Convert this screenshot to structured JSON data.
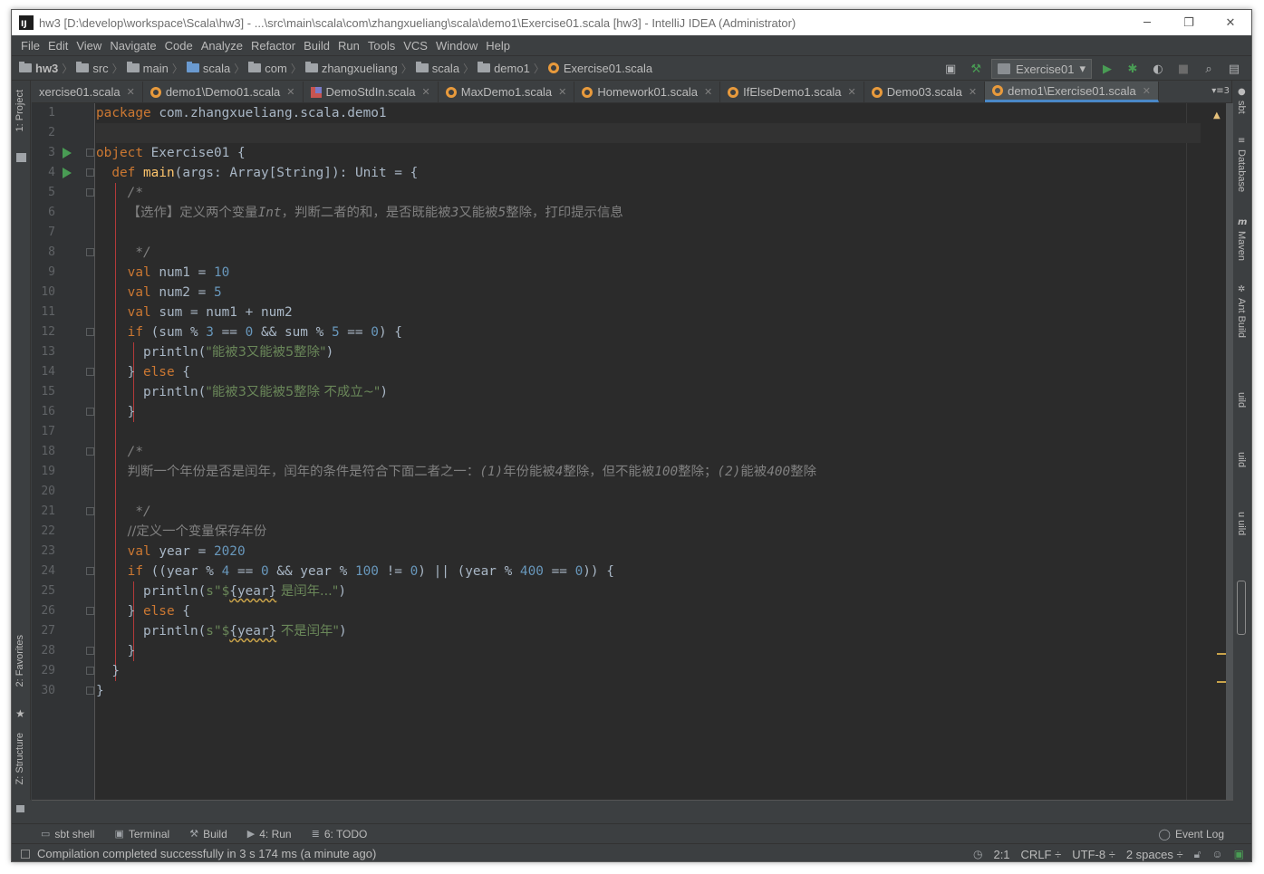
{
  "window": {
    "title": "hw3 [D:\\develop\\workspace\\Scala\\hw3] - ...\\src\\main\\scala\\com\\zhangxueliang\\scala\\demo1\\Exercise01.scala [hw3] - IntelliJ IDEA (Administrator)",
    "app_icon_text": "IJ",
    "controls": [
      "─",
      "❐",
      "✕"
    ]
  },
  "menu": [
    "File",
    "Edit",
    "View",
    "Navigate",
    "Code",
    "Analyze",
    "Refactor",
    "Build",
    "Run",
    "Tools",
    "VCS",
    "Window",
    "Help"
  ],
  "breadcrumbs": [
    "hw3",
    "src",
    "main",
    "scala",
    "com",
    "zhangxueliang",
    "scala",
    "demo1",
    "Exercise01.scala"
  ],
  "run_config": {
    "label": "Exercise01"
  },
  "tabs": [
    {
      "label": "xercise01.scala",
      "icon": "scala-icon",
      "active": false
    },
    {
      "label": "demo1\\Demo01.scala",
      "icon": "scala-icon",
      "active": false
    },
    {
      "label": "DemoStdIn.scala",
      "icon": "object-icon",
      "active": false
    },
    {
      "label": "MaxDemo1.scala",
      "icon": "scala-icon",
      "active": false
    },
    {
      "label": "Homework01.scala",
      "icon": "scala-icon",
      "active": false
    },
    {
      "label": "IfElseDemo1.scala",
      "icon": "scala-icon",
      "active": false
    },
    {
      "label": "Demo03.scala",
      "icon": "scala-icon",
      "active": false
    },
    {
      "label": "demo1\\Exercise01.scala",
      "icon": "scala-icon",
      "active": true
    }
  ],
  "tab_overflow": "▾≡3",
  "left_tool_tabs": {
    "project": "1: Project",
    "favorites": "2: Favorites",
    "structure": "Z: Structure"
  },
  "right_tool_tabs": {
    "sbt": "sbt",
    "database": "Database",
    "maven": "Maven",
    "ant": "Ant Build",
    "build1": "uild",
    "build2": "uild",
    "build3": "u uild"
  },
  "line_numbers": [
    "1",
    "2",
    "3",
    "4",
    "5",
    "6",
    "7",
    "8",
    "9",
    "10",
    "11",
    "12",
    "13",
    "14",
    "15",
    "16",
    "17",
    "18",
    "19",
    "20",
    "21",
    "22",
    "23",
    "24",
    "25",
    "26",
    "27",
    "28",
    "29",
    "30"
  ],
  "code": {
    "l1": {
      "kw": "package",
      "rest": " com.zhangxueliang.scala.demo1"
    },
    "l3": {
      "kw": "object",
      "name": " Exercise01",
      "rest": " {"
    },
    "l4": {
      "kw": "def",
      "fn": " main",
      "a": "(args: ",
      "ty": "Array",
      "b": "[String]): ",
      "unit": "Unit",
      "c": " = {"
    },
    "l5": "/*",
    "l6": {
      "a": "【选作】定义两个变量",
      "b": "Int",
      "c": "，判断二者的和，是否既能被",
      "d": "3",
      "e": "又能被",
      "f": "5",
      "g": "整除，打印提示信息"
    },
    "l8": " */",
    "l9": {
      "kw": "val",
      "a": " num1 = ",
      "num": "10"
    },
    "l10": {
      "kw": "val",
      "a": " num2 = ",
      "num": "5"
    },
    "l11": {
      "kw": "val",
      "a": " sum = num1 + num2"
    },
    "l12": {
      "kw": "if",
      "a": " (sum % ",
      "n1": "3",
      "b": " == ",
      "n2": "0",
      "c": " && sum % ",
      "n3": "5",
      "d": " == ",
      "n4": "0",
      "e": ") {"
    },
    "l13": {
      "a": "println(",
      "s": "\"能被3又能被5整除\"",
      "b": ")"
    },
    "l14": {
      "a": "} ",
      "kw": "else",
      "b": " {"
    },
    "l15": {
      "a": "println(",
      "s": "\"能被3又能被5整除 不成立~\"",
      "b": ")"
    },
    "l16": "}",
    "l18": "/*",
    "l19": {
      "a": "判断一个年份是否是闰年，闰年的条件是符合下面二者之一：",
      "b": "(1)",
      "c": "年份能被",
      "d": "4",
      "e": "整除，但不能被",
      "f": "100",
      "g": "整除；",
      "h": "(2)",
      "i": "能被",
      "j": "400",
      "k": "整除"
    },
    "l21": " */",
    "l22": "//定义一个变量保存年份",
    "l23": {
      "kw": "val",
      "a": " year = ",
      "num": "2020"
    },
    "l24": {
      "kw": "if",
      "a": " ((year % ",
      "n1": "4",
      "b": " == ",
      "n2": "0",
      "c": " && year % ",
      "n3": "100",
      "d": " != ",
      "n4": "0",
      "e": ") || (year % ",
      "n5": "400",
      "f": " == ",
      "n6": "0",
      "g": ")) {"
    },
    "l25": {
      "a": "println(",
      "s1": "s\"$",
      "i": "{year}",
      "s2": " 是闰年...\"",
      "b": ")"
    },
    "l26": {
      "a": "} ",
      "kw": "else",
      "b": " {"
    },
    "l27": {
      "a": "println(",
      "s1": "s\"$",
      "i": "{year}",
      "s2": " 不是闰年\"",
      "b": ")"
    },
    "l28": "}",
    "l29": "}",
    "l30": "}"
  },
  "bottom_tools": [
    {
      "label": "sbt shell",
      "icon": "sbt-shell-icon"
    },
    {
      "label": "Terminal",
      "icon": "terminal-icon"
    },
    {
      "label": "Build",
      "icon": "build-icon"
    },
    {
      "label": "4: Run",
      "icon": "run-icon"
    },
    {
      "label": "6: TODO",
      "icon": "todo-icon"
    }
  ],
  "event_log": "Event Log",
  "status": {
    "message": "Compilation completed successfully in 3 s 174 ms (a minute ago)",
    "position": "2:1",
    "line_sep": "CRLF ÷",
    "encoding": "UTF-8 ÷",
    "indent": "2 spaces ÷"
  },
  "colors": {
    "keyword": "#cc7832",
    "function": "#ffc66d",
    "number": "#6897bb",
    "string": "#6a8759",
    "comment": "#808080",
    "active_tab_underline": "#4a88c7",
    "run_marker": "#499c54"
  }
}
